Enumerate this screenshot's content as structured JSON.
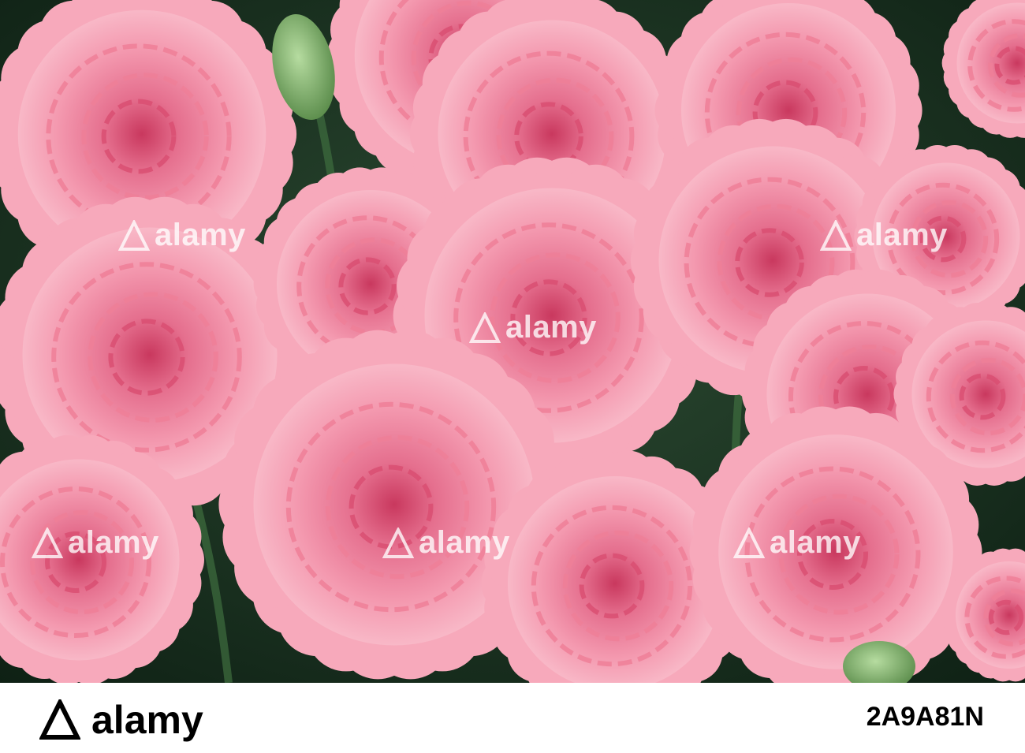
{
  "photo": {
    "subject": "pink-carnation-flowers",
    "colors": {
      "background": "#1d3a26",
      "petal_light": "#f7a9bb",
      "petal_mid": "#ee7f98",
      "petal_dark": "#d94f72",
      "bud": "#8fc07a"
    }
  },
  "watermark": {
    "brand": "alamy"
  },
  "footer": {
    "brand": "alamy",
    "image_id": "2A9A81N"
  }
}
